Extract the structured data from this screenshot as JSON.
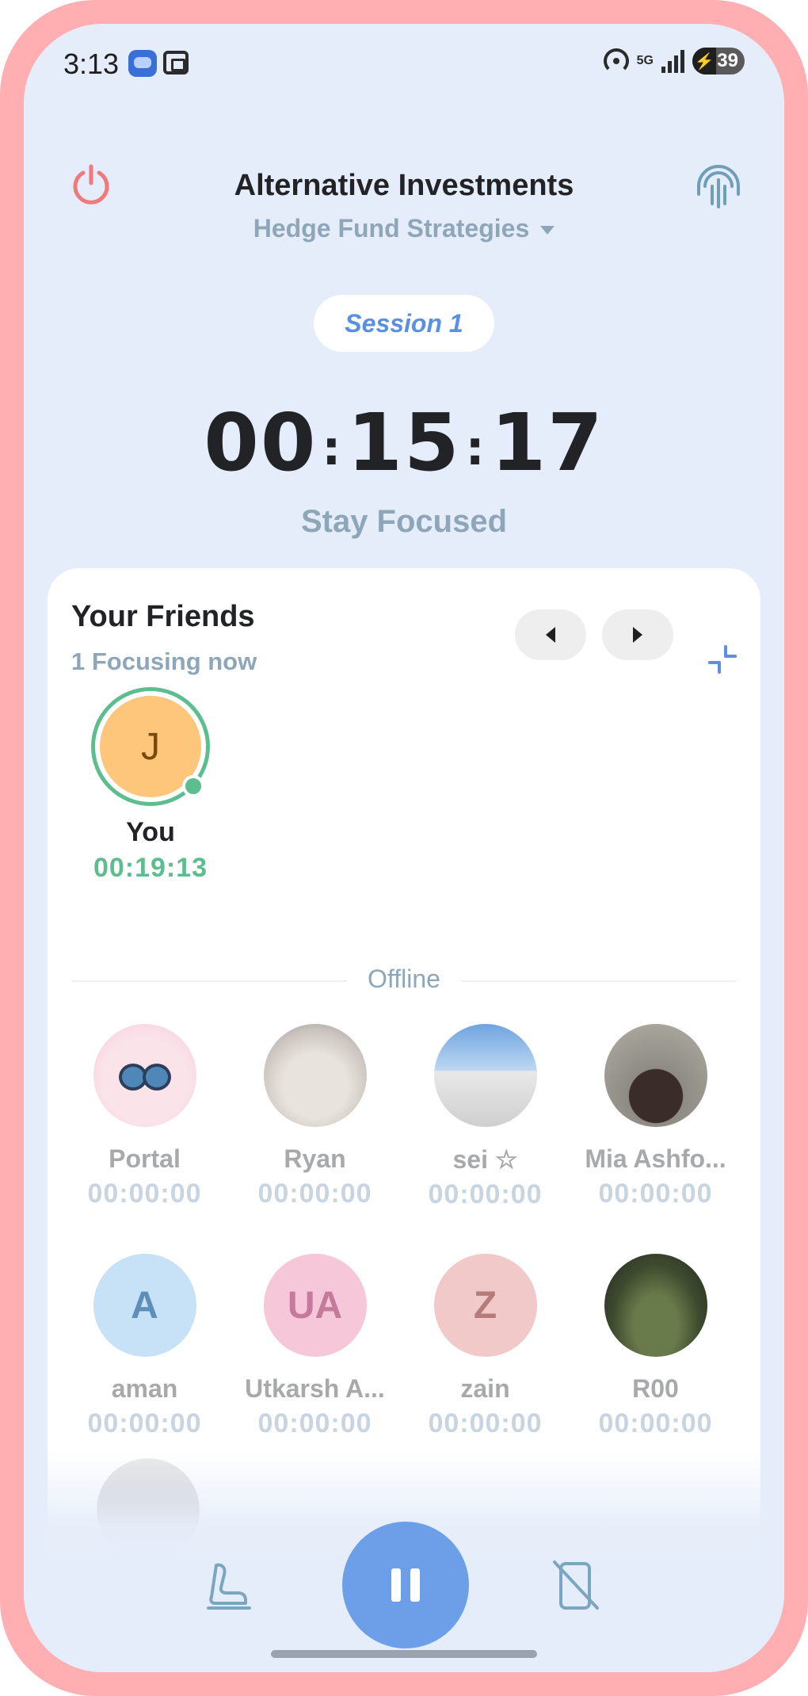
{
  "status_bar": {
    "time": "3:13",
    "network": "5G",
    "battery": "39"
  },
  "header": {
    "title": "Alternative Investments",
    "subtitle": "Hedge Fund Strategies"
  },
  "session": {
    "label": "Session 1",
    "timer_hours": "00",
    "timer_minutes": "15",
    "timer_seconds": "17",
    "motivation": "Stay Focused"
  },
  "friends": {
    "title": "Your Friends",
    "focusing_count": "1 Focusing now",
    "you": {
      "initial": "J",
      "name": "You",
      "time": "00:19:13"
    },
    "offline_label": "Offline",
    "offline": [
      {
        "name": "Portal",
        "time": "00:00:00",
        "initials": ""
      },
      {
        "name": "Ryan",
        "time": "00:00:00",
        "initials": ""
      },
      {
        "name": "sei ☆",
        "time": "00:00:00",
        "initials": ""
      },
      {
        "name": "Mia Ashfo...",
        "time": "00:00:00",
        "initials": ""
      },
      {
        "name": "aman",
        "time": "00:00:00",
        "initials": "A"
      },
      {
        "name": "Utkarsh A...",
        "time": "00:00:00",
        "initials": "UA"
      },
      {
        "name": "zain",
        "time": "00:00:00",
        "initials": "Z"
      },
      {
        "name": "R00",
        "time": "00:00:00",
        "initials": ""
      }
    ]
  },
  "colors": {
    "accent": "#6c9fe8",
    "online": "#5cbd8e",
    "power": "#f07a7a",
    "muted": "#8da6b8",
    "frame": "#ffafb2",
    "background": "#e6edfa"
  },
  "icons": {
    "power": "power-icon",
    "sound": "waveform-icon",
    "prev": "caret-left-icon",
    "next": "caret-right-icon",
    "collapse": "collapse-icon",
    "seat": "seat-icon",
    "pause": "pause-icon",
    "no_phone": "no-phone-icon"
  }
}
